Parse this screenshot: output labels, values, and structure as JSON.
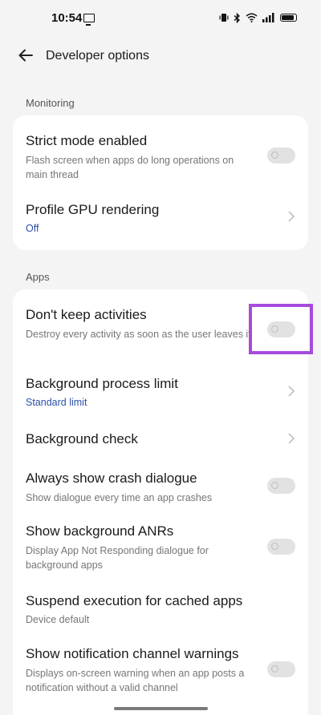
{
  "status_bar": {
    "time": "10:54",
    "battery_level": 0.88
  },
  "header": {
    "title": "Developer options",
    "back_icon": "arrow-left-icon"
  },
  "sections": {
    "monitoring": {
      "label": "Monitoring",
      "items": [
        {
          "title": "Strict mode enabled",
          "desc": "Flash screen when apps do long operations on main thread",
          "type": "toggle",
          "on": false
        },
        {
          "title": "Profile GPU rendering",
          "value": "Off",
          "type": "chevron"
        }
      ]
    },
    "apps": {
      "label": "Apps",
      "items": [
        {
          "title": "Don't keep activities",
          "desc": "Destroy every activity as soon as the user leaves it",
          "type": "toggle",
          "on": false
        },
        {
          "title": "Background process limit",
          "value": "Standard limit",
          "type": "chevron"
        },
        {
          "title": "Background check",
          "type": "chevron"
        },
        {
          "title": "Always show crash dialogue",
          "desc": "Show dialogue every time an app crashes",
          "type": "toggle",
          "on": false
        },
        {
          "title": "Show background ANRs",
          "desc": "Display App Not Responding dialogue for background apps",
          "type": "toggle",
          "on": false
        },
        {
          "title": "Suspend execution for cached apps",
          "value": "Device default",
          "type": "plain"
        },
        {
          "title": "Show notification channel warnings",
          "desc": "Displays on-screen warning when an app posts a notification without a valid channel",
          "type": "toggle",
          "on": false
        }
      ]
    }
  },
  "colors": {
    "accent_value": "#2a4fa8",
    "highlight": "#a64bdc",
    "background": "#f4f4f4"
  }
}
